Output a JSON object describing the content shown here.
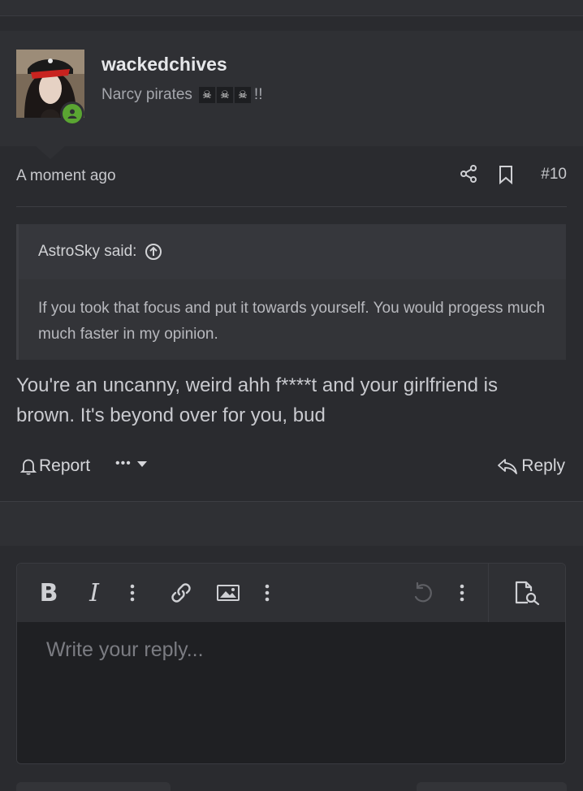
{
  "post": {
    "username": "wackedchives",
    "user_title": "Narcy pirates",
    "title_suffix": "!!",
    "skull_glyph": "☠",
    "timestamp": "A moment ago",
    "post_number": "#10",
    "quote": {
      "author": "AstroSky said:",
      "body": "If you took that focus and put it towards yourself. You would progess much much faster in my opinion."
    },
    "message": "You're an uncanny, weird ahh f****t and your girlfriend is brown. It's beyond over for you, bud",
    "actions": {
      "report": "Report",
      "more": "•••",
      "reply": "Reply"
    }
  },
  "editor": {
    "bold": "B",
    "italic": "I",
    "placeholder": "Write your reply..."
  },
  "colors": {
    "background": "#2a2b2f",
    "header_bg": "#2f3034",
    "online": "#5aa532",
    "text": "#c9cacf"
  }
}
